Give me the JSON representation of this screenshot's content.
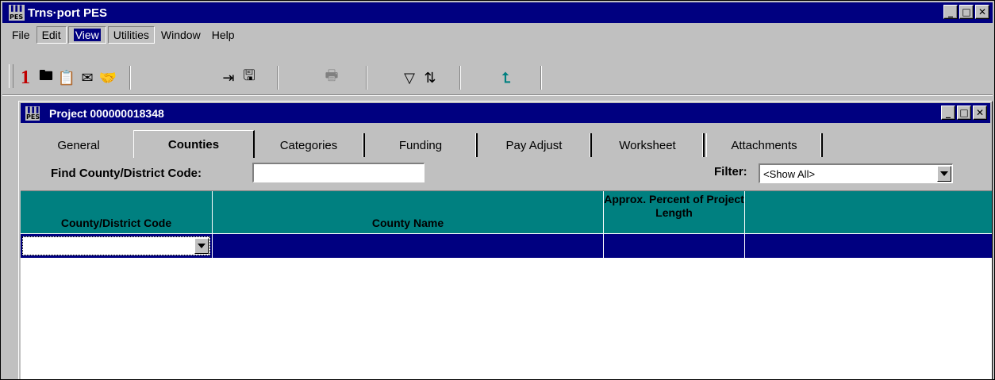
{
  "app": {
    "title": "Trns·port PES",
    "icon_text": "PES",
    "window_buttons": [
      "minimize-icon",
      "maximize-icon",
      "close-icon"
    ]
  },
  "menu": [
    {
      "label": "File"
    },
    {
      "label": "Edit"
    },
    {
      "label": "View"
    },
    {
      "label": "Utilities"
    },
    {
      "label": "Window"
    },
    {
      "label": "Help"
    }
  ],
  "toolbar": {
    "groups": [
      [
        "one-icon",
        "open-folder-icon",
        "clipboard-icon",
        "mail-icon",
        "handshake-icon"
      ],
      [
        "exit-door-icon",
        "save-disk-icon"
      ],
      [
        "print-icon"
      ],
      [
        "filter-icon",
        "sort-az-icon"
      ],
      [
        "up-arrow-icon"
      ]
    ],
    "glyphs": {
      "one": "1",
      "open": "🖿",
      "clipboard": "📋",
      "mail": "✉",
      "handshake": "🤝",
      "exit": "⇥",
      "save": "🖫",
      "print": "🖶",
      "filter": "▽",
      "sort": "⇅",
      "up": "⮤"
    }
  },
  "child_window": {
    "title": "Project 000000018348",
    "icon_text": "PES"
  },
  "tabs": [
    {
      "label": "General"
    },
    {
      "label": "Counties",
      "active": true
    },
    {
      "label": "Categories"
    },
    {
      "label": "Funding"
    },
    {
      "label": "Pay Adjust"
    },
    {
      "label": "Worksheet"
    },
    {
      "label": "Attachments"
    }
  ],
  "find": {
    "label": "Find County/District Code:",
    "value": ""
  },
  "filter": {
    "label": "Filter:",
    "value": "<Show All>"
  },
  "grid": {
    "columns": [
      {
        "label": "County/District Code"
      },
      {
        "label": "County Name"
      },
      {
        "label": "Approx. Percent of Project Length"
      },
      {
        "label": ""
      }
    ],
    "rows": [
      {
        "code": "",
        "name": "",
        "percent": ""
      }
    ]
  },
  "colors": {
    "title_bar": "#000080",
    "header": "#008080",
    "selected_row": "#000080",
    "face": "#c0c0c0"
  }
}
